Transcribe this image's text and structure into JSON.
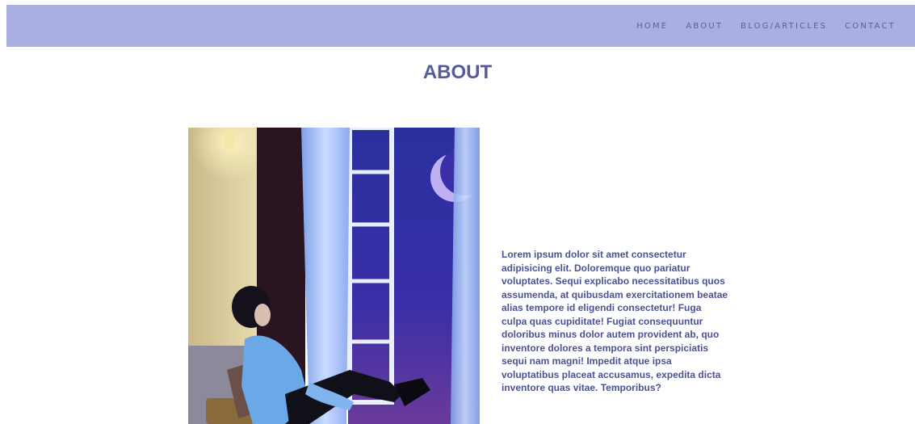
{
  "nav": {
    "items": [
      {
        "label": "HOME"
      },
      {
        "label": "ABOUT"
      },
      {
        "label": "BLOG/ARTICLES"
      },
      {
        "label": "CONTACT"
      }
    ]
  },
  "main": {
    "title": "ABOUT",
    "image": {
      "description_icon": "photo-person-by-window-moon"
    },
    "paragraph": "Lorem ipsum dolor sit amet consectetur adipisicing elit. Doloremque quo pariatur voluptates. Sequi explicabo necessitatibus quos assumenda, at quibusdam exercitationem beatae alias tempore id eligendi consectetur! Fuga culpa quas cupiditate! Fugiat consequuntur doloribus minus dolor autem provident ab, quo inventore dolores a tempora sint perspiciatis sequi nam magni! Impedit atque ipsa voluptatibus placeat accusamus, expedita dicta inventore quas vitae. Temporibus?"
  },
  "colors": {
    "navbar_bg": "#abaee0",
    "nav_text": "#5a5f9a",
    "title": "#565c98",
    "body_text": "#4c5194"
  }
}
